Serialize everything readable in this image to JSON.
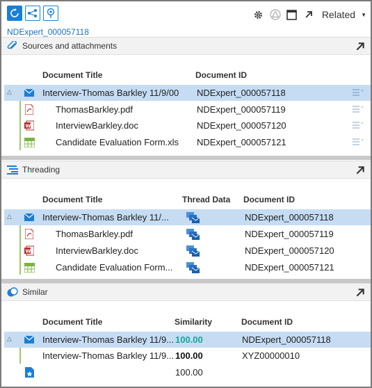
{
  "toolbar": {
    "buttons": [
      "refresh-icon",
      "share-nodes-icon",
      "pin-icon"
    ],
    "right_icons": [
      "gear-icon",
      "warning-icon",
      "window-icon",
      "popout-icon"
    ],
    "related_label": "Related"
  },
  "header_doc_id": "NDExpert_000057118",
  "colors": {
    "accent": "#1a7fd4",
    "selected_row": "#c5dcf3",
    "similarity_green": "#17a59b"
  },
  "sources": {
    "title": "Sources and attachments",
    "columns": {
      "title": "Document Title",
      "id": "Document ID"
    },
    "rows": [
      {
        "icon": "email-icon",
        "title": "Interview-Thomas Barkley 11/9/00",
        "id": "NDExpert_000057118",
        "selected": true
      },
      {
        "icon": "pdf-icon",
        "title": "ThomasBarkley.pdf",
        "id": "NDExpert_000057119"
      },
      {
        "icon": "word-icon",
        "title": "InterviewBarkley.doc",
        "id": "NDExpert_000057120"
      },
      {
        "icon": "excel-icon",
        "title": "Candidate Evaluation Form.xls",
        "id": "NDExpert_000057121"
      }
    ]
  },
  "threading": {
    "title": "Threading",
    "columns": {
      "title": "Document Title",
      "thread": "Thread Data",
      "id": "Document ID"
    },
    "rows": [
      {
        "icon": "email-icon",
        "title": "Interview-Thomas Barkley 11/...",
        "id": "NDExpert_000057118",
        "selected": true
      },
      {
        "icon": "pdf-icon",
        "title": "ThomasBarkley.pdf",
        "id": "NDExpert_000057119"
      },
      {
        "icon": "word-icon",
        "title": "InterviewBarkley.doc",
        "id": "NDExpert_000057120"
      },
      {
        "icon": "excel-icon",
        "title": "Candidate Evaluation Form...",
        "id": "NDExpert_000057121"
      }
    ]
  },
  "similar": {
    "title": "Similar",
    "columns": {
      "title": "Document Title",
      "similarity": "Similarity",
      "id": "Document ID"
    },
    "rows": [
      {
        "icon": "email-icon",
        "title": "Interview-Thomas Barkley 11/9...",
        "similarity": "100.00",
        "id": "NDExpert_000057118",
        "selected": true
      },
      {
        "title": "Interview-Thomas Barkley 11/9...",
        "similarity": "100.00",
        "id": "XYZ00000010"
      },
      {
        "icon": "starred-file-icon",
        "title": "",
        "similarity": "100.00",
        "id": ""
      }
    ]
  }
}
